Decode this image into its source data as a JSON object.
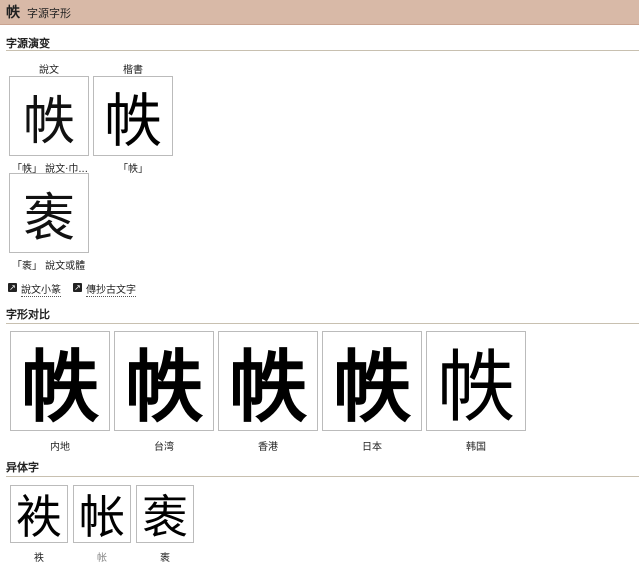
{
  "header": {
    "char": "帙",
    "title": "字源字形"
  },
  "evolution": {
    "title": "字源演变",
    "col_headers": [
      "說文",
      "楷書"
    ],
    "items": [
      {
        "glyph": "帙",
        "caption": "「帙」 說文‧巾..."
      },
      {
        "glyph": "帙",
        "caption": "「帙」"
      },
      {
        "glyph": "袠",
        "caption": "「袠」 說文或體"
      }
    ],
    "links": [
      "說文小篆",
      "傳抄古文字"
    ]
  },
  "compare": {
    "title": "字形对比",
    "glyph": "帙",
    "regions": [
      "内地",
      "台湾",
      "香港",
      "日本",
      "韩国"
    ]
  },
  "variants": {
    "title": "异体字",
    "items": [
      {
        "glyph": "袟",
        "label": "袟"
      },
      {
        "glyph": "帐",
        "label": "帐"
      },
      {
        "glyph": "袠",
        "label": "袠"
      }
    ]
  }
}
